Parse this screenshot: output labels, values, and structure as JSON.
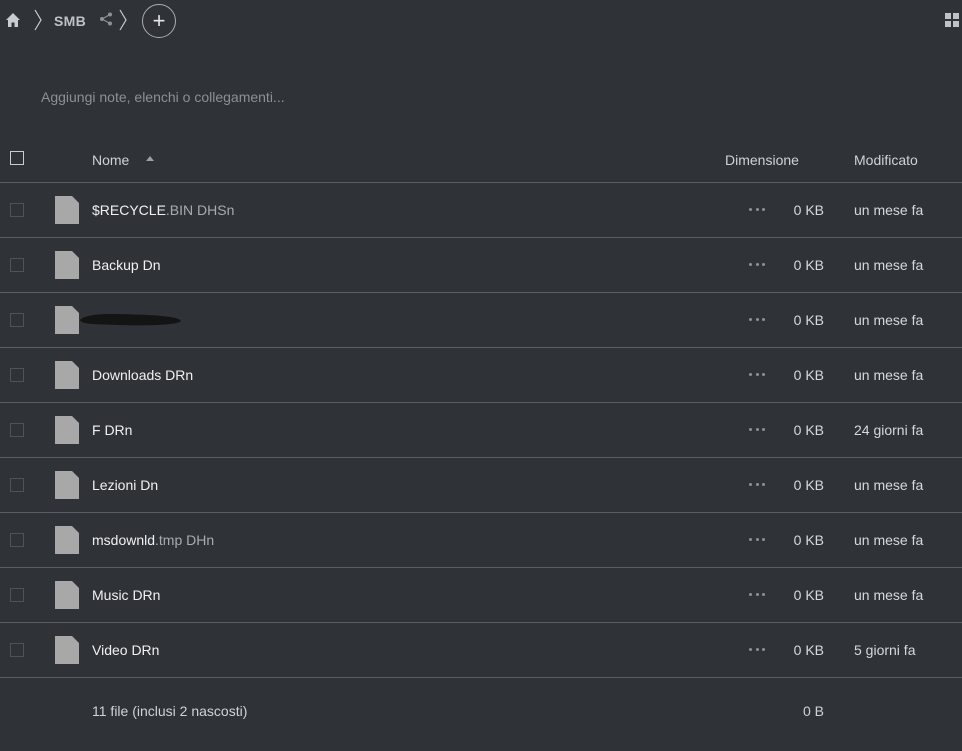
{
  "breadcrumb": {
    "current": "SMB"
  },
  "notes": {
    "placeholder": "Aggiungi note, elenchi o collegamenti..."
  },
  "table": {
    "headers": {
      "name": "Nome",
      "size": "Dimensione",
      "modified": "Modificato"
    },
    "rows": [
      {
        "base": "$RECYCLE",
        "ext": ".BIN DHSn",
        "size": "0 KB",
        "modified": "un mese fa"
      },
      {
        "base": "Backup Dn",
        "ext": "",
        "size": "0 KB",
        "modified": "un mese fa"
      },
      {
        "base": "",
        "ext": "",
        "size": "0 KB",
        "modified": "un mese fa",
        "redacted": true
      },
      {
        "base": "Downloads DRn",
        "ext": "",
        "size": "0 KB",
        "modified": "un mese fa"
      },
      {
        "base": "F DRn",
        "ext": "",
        "size": "0 KB",
        "modified": "24 giorni fa"
      },
      {
        "base": "Lezioni Dn",
        "ext": "",
        "size": "0 KB",
        "modified": "un mese fa"
      },
      {
        "base": "msdownld",
        "ext": ".tmp DHn",
        "size": "0 KB",
        "modified": "un mese fa"
      },
      {
        "base": "Music DRn",
        "ext": "",
        "size": "0 KB",
        "modified": "un mese fa"
      },
      {
        "base": "Video DRn",
        "ext": "",
        "size": "0 KB",
        "modified": "5 giorni fa"
      }
    ],
    "summary": {
      "count": "11 file (inclusi 2 nascosti)",
      "total": "0 B"
    }
  },
  "icons": {
    "home": "home-icon",
    "share": "share-icon",
    "add": "plus-icon",
    "view_toggle": "grid-view-icon",
    "file": "file-icon",
    "actions": "more-horizontal-icon"
  },
  "colors": {
    "background": "#2f3338",
    "row_border": "#5a5f66",
    "file_icon": "#a8a8a8",
    "text": "#f1f1f1",
    "muted": "#8b9096"
  }
}
